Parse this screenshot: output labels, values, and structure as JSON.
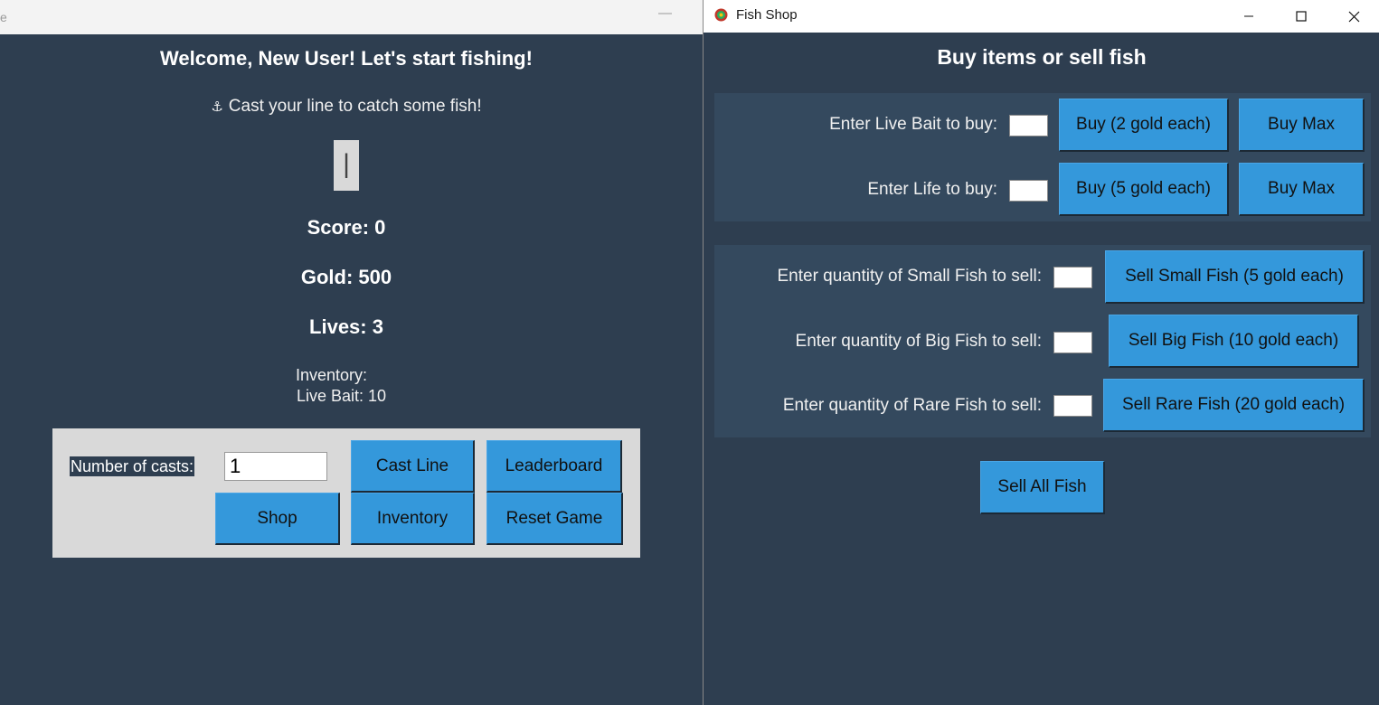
{
  "game_window": {
    "title_fragment": "e",
    "minimize_glyph": "—",
    "welcome": "Welcome, New User! Let's start fishing!",
    "status_icon": "fishing-hook-icon",
    "status": "Cast your line to catch some fish!",
    "rod_glyph": "|",
    "score": "Score: 0",
    "gold": "Gold: 500",
    "lives": "Lives: 3",
    "inventory_title": "Inventory:",
    "inventory_line": "Live Bait: 10",
    "casts_label": "Number of casts:",
    "casts_value": "1",
    "buttons": {
      "cast_line": "Cast Line",
      "leaderboard": "Leaderboard",
      "shop": "Shop",
      "inventory": "Inventory",
      "reset_game": "Reset Game"
    }
  },
  "shop_window": {
    "title": "Fish Shop",
    "heading": "Buy items or sell fish",
    "buy": [
      {
        "label": "Enter Live Bait to buy:",
        "button": "Buy (2 gold each)",
        "max_button": "Buy Max"
      },
      {
        "label": "Enter Life to buy:",
        "button": "Buy (5 gold each)",
        "max_button": "Buy Max"
      }
    ],
    "sell": [
      {
        "label": "Enter quantity of Small Fish to sell:",
        "button": "Sell Small Fish (5 gold each)"
      },
      {
        "label": "Enter quantity of Big Fish to sell:",
        "button": "Sell Big Fish (10 gold each)"
      },
      {
        "label": "Enter quantity of Rare Fish to sell:",
        "button": "Sell Rare Fish (20 gold each)"
      }
    ],
    "sell_all": "Sell All Fish"
  },
  "colors": {
    "background": "#2e3e50",
    "group_background": "#34495e",
    "button": "#3498db",
    "panel": "#d9d9d9"
  }
}
